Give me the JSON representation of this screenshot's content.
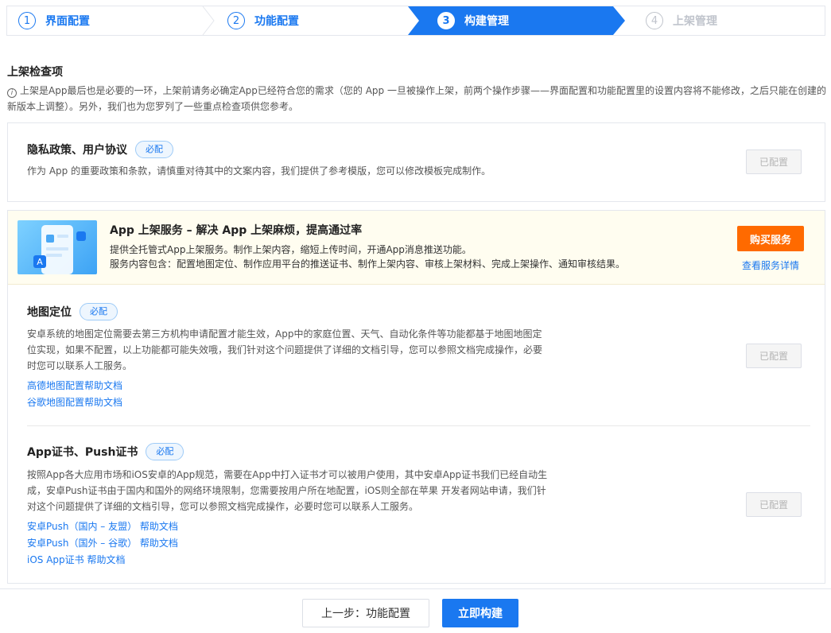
{
  "steps": [
    {
      "num": "1",
      "label": "界面配置",
      "state": "done"
    },
    {
      "num": "2",
      "label": "功能配置",
      "state": "done"
    },
    {
      "num": "3",
      "label": "构建管理",
      "state": "active"
    },
    {
      "num": "4",
      "label": "上架管理",
      "state": "todo"
    }
  ],
  "section": {
    "title": "上架检查项",
    "notice": "上架是App最后也是必要的一环，上架前请务必确定App已经符合您的需求（您的 App 一旦被操作上架，前两个操作步骤——界面配置和功能配置里的设置内容将不能修改，之后只能在创建的新版本上调整）。另外，我们也为您罗列了一些重点检查项供您参考。"
  },
  "privacy": {
    "title": "隐私政策、用户协议",
    "badge": "必配",
    "desc": "作为 App 的重要政策和条款，请慎重对待其中的文案内容，我们提供了参考模版，您可以修改模板完成制作。",
    "button": "已配置"
  },
  "promo": {
    "title": "App 上架服务 – 解决 App 上架麻烦，提高通过率",
    "line1": "提供全托管式App上架服务。制作上架内容，缩短上传时间，开通App消息推送功能。",
    "line2": "服务内容包含：配置地图定位、制作应用平台的推送证书、制作上架内容、审核上架材料、完成上架操作、通知审核结果。",
    "buy_label": "购买服务",
    "detail_label": "查看服务详情"
  },
  "map": {
    "title": "地图定位",
    "badge": "必配",
    "desc_lines": [
      "安卓系统的地图定位需要去第三方机构申请配置才能生效，App中的家庭位置、天气、自动化条件等功能都基于地图地图定",
      "位实现，如果不配置，以上功能都可能失效哦，我们针对这个问题提供了详细的文档引导，您可以参照文档完成操作，必要",
      "时您可以联系人工服务。"
    ],
    "links": [
      "高德地图配置帮助文档",
      "谷歌地图配置帮助文档"
    ],
    "button": "已配置"
  },
  "cert": {
    "title": "App证书、Push证书",
    "badge": "必配",
    "desc_lines": [
      "按照App各大应用市场和iOS安卓的App规范，需要在App中打入证书才可以被用户使用，其中安卓App证书我们已经自动生",
      "成，安卓Push证书由于国内和国外的网络环境限制，您需要按用户所在地配置，iOS则全部在苹果 开发者网站申请，我们针",
      "对这个问题提供了详细的文档引导，您可以参照文档完成操作，必要时您可以联系人工服务。"
    ],
    "links": [
      "安卓Push（国内 – 友盟） 帮助文档",
      "安卓Push（国外 – 谷歌） 帮助文档",
      "iOS App证书 帮助文档"
    ],
    "button": "已配置"
  },
  "footer": {
    "prev_label": "上一步：功能配置",
    "build_label": "立即构建"
  },
  "colors": {
    "primary": "#1a78f0",
    "accent": "#ff6a00",
    "disabled": "#c0c4cc"
  }
}
